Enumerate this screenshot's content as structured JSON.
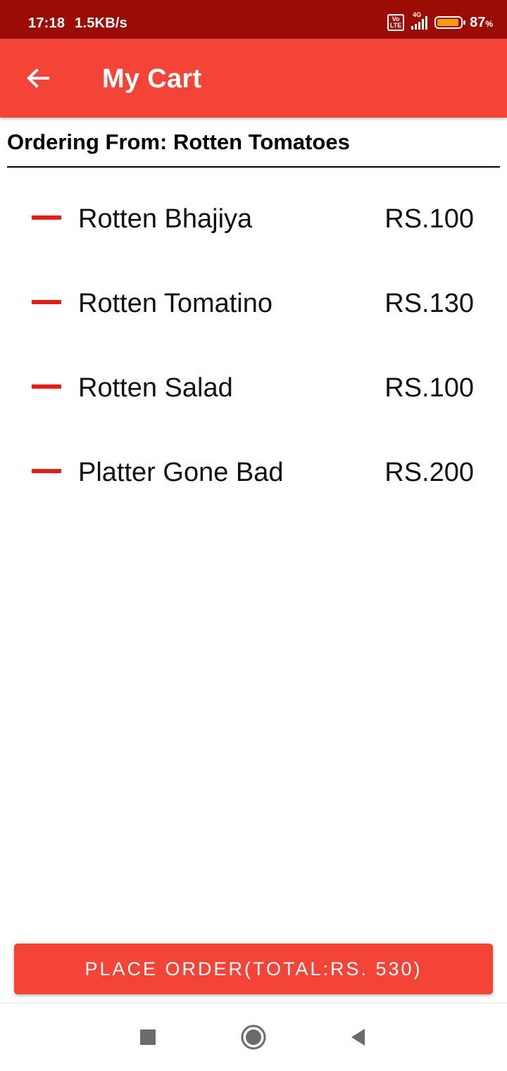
{
  "status_bar": {
    "time": "17:18",
    "speed": "1.5KB/s",
    "network_badge": "Vo\nLTE",
    "network_type": "4G",
    "battery_level": 87,
    "battery_text": "87",
    "battery_unit": "%"
  },
  "app_bar": {
    "title": "My Cart",
    "back_icon": "arrow-left-icon",
    "color": "#f44337"
  },
  "restaurant": {
    "ordering_from": "Ordering From: Rotten Tomatoes"
  },
  "cart": {
    "items": [
      {
        "name": "Rotten Bhajiya",
        "price": "RS.100"
      },
      {
        "name": "Rotten Tomatino",
        "price": "RS.130"
      },
      {
        "name": "Rotten Salad",
        "price": "RS.100"
      },
      {
        "name": "Platter Gone Bad",
        "price": "RS.200"
      }
    ],
    "remove_icon": "minus-icon",
    "remove_color": "#e51d17"
  },
  "footer": {
    "place_order_label": "PLACE ORDER(TOTAL:RS. 530)"
  },
  "nav_bar": {
    "recents_icon": "square-icon",
    "home_icon": "circle-icon",
    "back_icon": "triangle-back-icon"
  },
  "colors": {
    "status_bar": "#9b0d04",
    "accent": "#f44337"
  }
}
